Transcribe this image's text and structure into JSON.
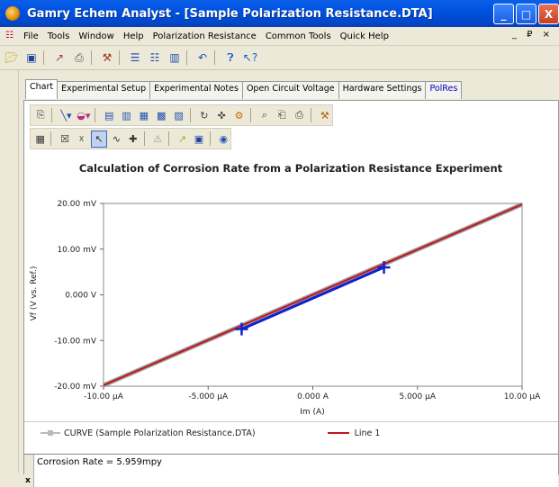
{
  "window": {
    "title": "Gamry Echem Analyst - [Sample Polarization Resistance.DTA]",
    "minimize_glyph": "_",
    "maximize_glyph": "□",
    "close_glyph": "X"
  },
  "menu": {
    "items": [
      "File",
      "Tools",
      "Window",
      "Help",
      "Polarization Resistance",
      "Common Tools",
      "Quick Help"
    ],
    "mdi_controls": "_ ₽ ×"
  },
  "tabs": [
    {
      "label": "Chart",
      "active": true
    },
    {
      "label": "Experimental Setup",
      "active": false
    },
    {
      "label": "Experimental Notes",
      "active": false
    },
    {
      "label": "Open Circuit Voltage",
      "active": false
    },
    {
      "label": "Hardware Settings",
      "active": false
    },
    {
      "label": "PolRes",
      "active": false
    }
  ],
  "chart_data": {
    "type": "line",
    "title": "Calculation of Corrosion Rate from a Polarization Resistance Experiment",
    "xlabel": "Im (A)",
    "ylabel": "Vf (V vs. Ref.)",
    "xlim": [
      -1e-05,
      1e-05
    ],
    "ylim": [
      -0.02,
      0.02
    ],
    "x_ticks": [
      -1e-05,
      -5e-06,
      0,
      5e-06,
      1e-05
    ],
    "x_tick_labels": [
      "-10.00 µA",
      "-5.000 µA",
      "0.000 A",
      "5.000 µA",
      "10.00 µA"
    ],
    "y_ticks": [
      0.02,
      0.01,
      0,
      -0.01,
      -0.02
    ],
    "y_tick_labels": [
      "20.00 mV",
      "10.00 mV",
      "0.000 V",
      "-10.00 mV",
      "-20.00 mV"
    ],
    "grid": false,
    "legend_position": "bottom",
    "series": [
      {
        "name": "CURVE (Sample Polarization Resistance.DTA)",
        "color": "#a0a0a0",
        "x": [
          -1e-05,
          1e-05
        ],
        "y": [
          -0.0198,
          0.0198
        ]
      },
      {
        "name": "Line 1",
        "color": "#c0141c",
        "x": [
          -1e-05,
          1e-05
        ],
        "y": [
          -0.0198,
          0.0198
        ]
      },
      {
        "name": "",
        "color": "#1020d0",
        "x": [
          -3.4e-06,
          3.4e-06
        ],
        "y": [
          -0.0075,
          0.006
        ]
      }
    ],
    "markers": [
      {
        "x": -3.4e-06,
        "y": -0.0075,
        "color": "#1020d0"
      },
      {
        "x": 3.4e-06,
        "y": 0.006,
        "color": "#1020d0"
      }
    ]
  },
  "legend": {
    "curve_label": "CURVE (Sample Polarization Resistance.DTA)",
    "line_label": "Line 1"
  },
  "status": {
    "text": "Corrosion Rate = 5.959mpy",
    "close_glyph": "x"
  }
}
